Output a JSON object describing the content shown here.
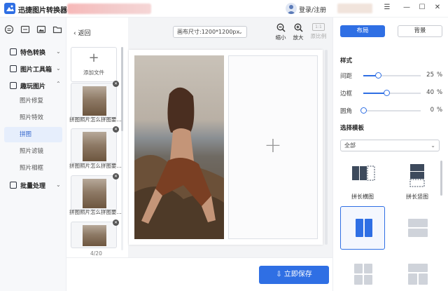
{
  "app": {
    "title": "迅捷图片转换器",
    "login_label": "登录/注册",
    "window_controls": [
      "menu-icon",
      "minimize-icon",
      "maximize-icon",
      "close-icon"
    ]
  },
  "sidebar": {
    "tool_icons": [
      "chat-icon",
      "ocr-icon",
      "image-icon",
      "folder-icon"
    ],
    "groups": [
      {
        "label": "特色转换",
        "expanded": false
      },
      {
        "label": "图片工具箱",
        "expanded": false
      },
      {
        "label": "趣玩图片",
        "expanded": true,
        "items": [
          "图片修复",
          "照片特效",
          "拼图",
          "照片滤镜",
          "照片相框"
        ],
        "active": "拼图"
      },
      {
        "label": "批量处理",
        "expanded": false
      }
    ]
  },
  "files": {
    "back_label": "返回",
    "add_label": "添加文件",
    "items": [
      {
        "caption": "拼图照片怎么拼图要..."
      },
      {
        "caption": "拼图照片怎么拼图要..."
      },
      {
        "caption": "拼图照片怎么拼图要..."
      },
      {
        "caption": ""
      }
    ],
    "count": "4/20"
  },
  "canvas": {
    "size_label": "画布尺寸:1200*1200px",
    "zoom_out": "缩小",
    "zoom_in": "放大",
    "ratio_value": "1:1",
    "ratio_label": "原比例"
  },
  "bottom": {
    "save_label": "立即保存"
  },
  "panel": {
    "tab_layout": "布局",
    "tab_background": "背景",
    "style_title": "样式",
    "spacing": {
      "label": "间距",
      "value": "25",
      "unit": "%",
      "level": 0.25
    },
    "border": {
      "label": "边框",
      "value": "40",
      "unit": "%",
      "level": 0.4
    },
    "radius": {
      "label": "圆角",
      "value": "0",
      "unit": "%",
      "level": 0
    },
    "template_title": "选择模板",
    "template_filter": "全部",
    "templates": [
      {
        "label": "拼长横图"
      },
      {
        "label": "拼长竖图"
      },
      {
        "label": ""
      },
      {
        "label": ""
      },
      {
        "label": ""
      },
      {
        "label": ""
      }
    ],
    "accent_color": "#2f6fe4"
  }
}
